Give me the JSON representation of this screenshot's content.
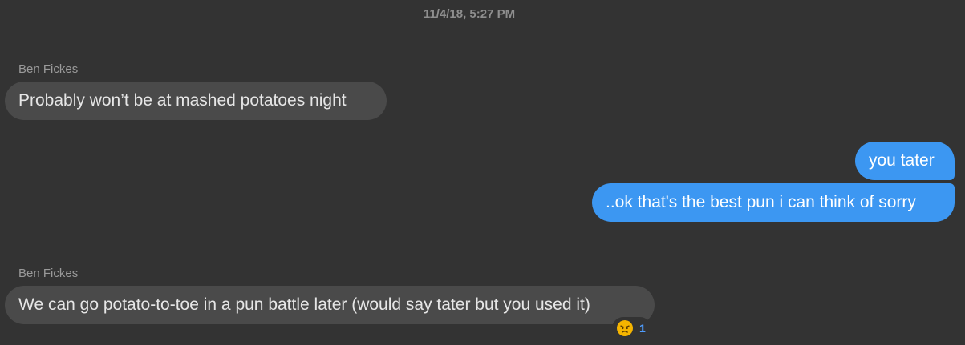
{
  "conversation": {
    "timestamp": "11/4/18, 5:27 PM",
    "messages": [
      {
        "sender": "Ben Fickes",
        "text": "Probably won’t be at mashed potatoes night",
        "direction": "incoming"
      },
      {
        "sender": "",
        "text": "you tater",
        "direction": "outgoing"
      },
      {
        "sender": "",
        "text": "..ok that's the best pun i can think of sorry",
        "direction": "outgoing"
      },
      {
        "sender": "Ben Fickes",
        "text": "We can go potato-to-toe in a pun battle later (would say tater but you used it)",
        "direction": "incoming",
        "reaction": {
          "icon": "angry-face-icon",
          "count": "1"
        }
      }
    ]
  },
  "colors": {
    "background": "#333333",
    "incoming_bubble": "#4a4a4a",
    "outgoing_bubble": "#3c97f2",
    "reaction_count": "#4f9dff"
  }
}
